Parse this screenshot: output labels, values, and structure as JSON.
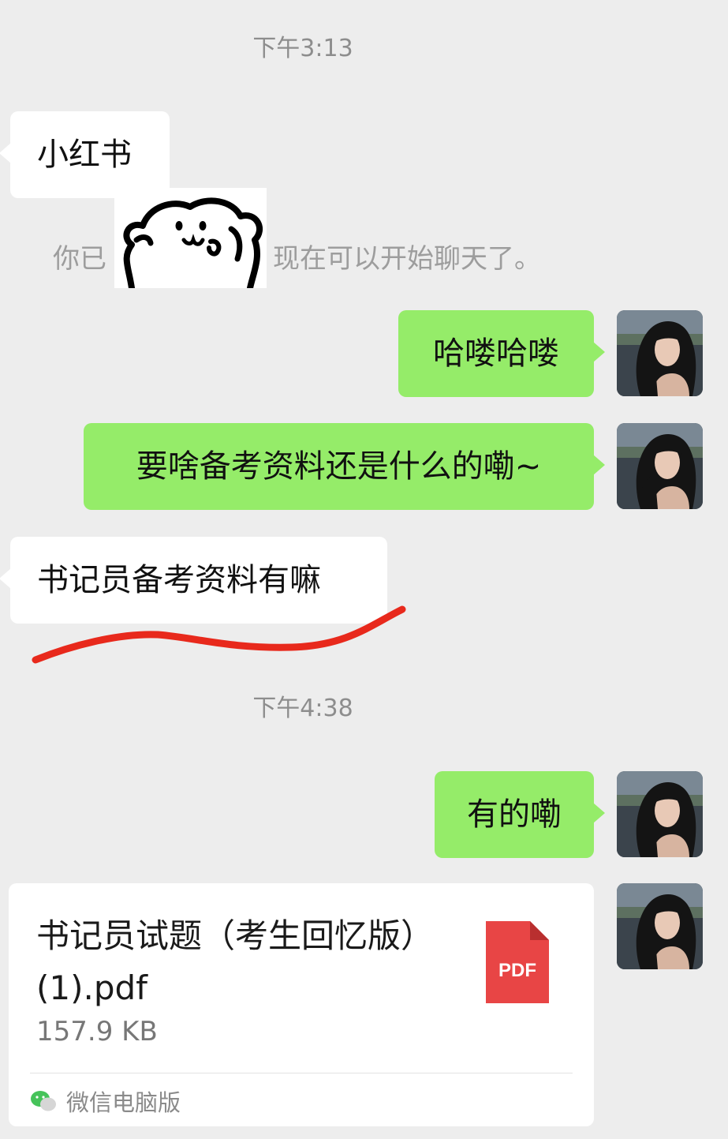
{
  "chat": {
    "timestamp_1": "下午3:13",
    "timestamp_2": "下午4:38",
    "system_prefix": "你已",
    "system_suffix": "现在可以开始聊天了。",
    "messages": {
      "m1": "小红书",
      "m2": "哈喽哈喽",
      "m3": "要啥备考资料还是什么的嘞~",
      "m4": "书记员备考资料有嘛",
      "m5": "有的嘞"
    },
    "file": {
      "name": "书记员试题（考生回忆版）(1).pdf",
      "size": "157.9 KB",
      "icon_label": "PDF",
      "source": "微信电脑版"
    }
  },
  "colors": {
    "background": "#ededed",
    "incoming_bubble": "#ffffff",
    "outgoing_bubble": "#95ec69",
    "pdf_icon": "#e84545",
    "annotation_line": "#e8291c"
  },
  "icons": {
    "sticker": "cartoon-bear-sticker",
    "avatar": "user-avatar-photo",
    "pdf": "pdf-file-icon",
    "source": "wechat-icon"
  }
}
